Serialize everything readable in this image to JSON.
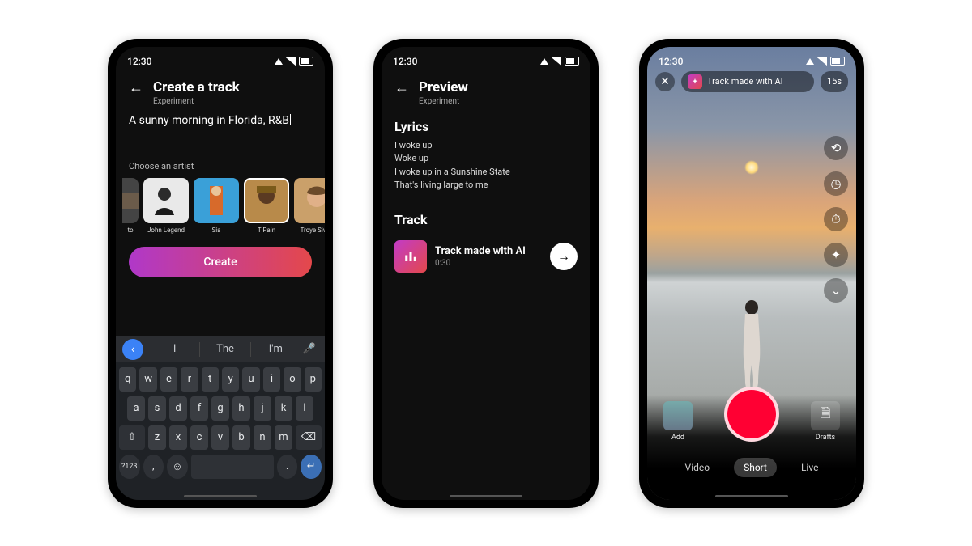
{
  "status": {
    "time": "12:30"
  },
  "phone1": {
    "title": "Create a track",
    "subtitle": "Experiment",
    "prompt": "A sunny morning in Florida, R&B",
    "choose_label": "Choose an artist",
    "artists": [
      {
        "name": "to"
      },
      {
        "name": "John Legend"
      },
      {
        "name": "Sia"
      },
      {
        "name": "T Pain"
      },
      {
        "name": "Troye Sivan"
      }
    ],
    "create_label": "Create",
    "suggestions": {
      "s1": "I",
      "s2": "The",
      "s3": "I'm"
    },
    "keys": {
      "row1": [
        "q",
        "w",
        "e",
        "r",
        "t",
        "y",
        "u",
        "i",
        "o",
        "p"
      ],
      "row2": [
        "a",
        "s",
        "d",
        "f",
        "g",
        "h",
        "j",
        "k",
        "l"
      ],
      "row3": [
        "z",
        "x",
        "c",
        "v",
        "b",
        "n",
        "m"
      ],
      "symbols": "?123",
      "comma": ",",
      "period": "."
    }
  },
  "phone2": {
    "title": "Preview",
    "subtitle": "Experiment",
    "lyrics_heading": "Lyrics",
    "lyrics": [
      "I woke up",
      "Woke up",
      "I woke up in a Sunshine State",
      "That's living large to me"
    ],
    "track_heading": "Track",
    "track_name": "Track made with AI",
    "track_duration": "0:30"
  },
  "phone3": {
    "pill_label": "Track made with AI",
    "duration": "15s",
    "add_label": "Add",
    "drafts_label": "Drafts",
    "tabs": {
      "video": "Video",
      "short": "Short",
      "live": "Live"
    }
  }
}
